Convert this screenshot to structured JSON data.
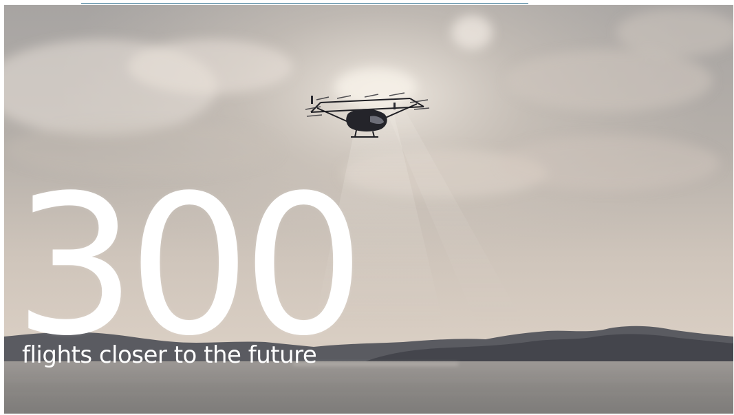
{
  "top_link": {
    "text": ""
  },
  "banner": {
    "number": "300",
    "tagline": "flights closer to the future"
  },
  "colors": {
    "text": "#ffffff",
    "link": "#2f6e8e",
    "sky_top": "#9c9a98",
    "sky_glow": "#e7dfd6",
    "water": "#8d8b88",
    "mountains": "#4e4f54"
  }
}
